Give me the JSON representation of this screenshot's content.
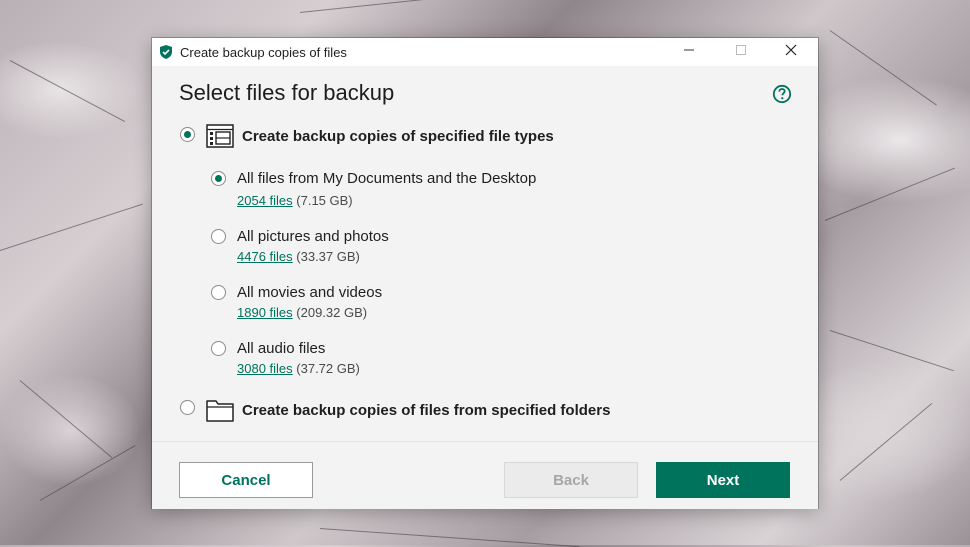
{
  "window": {
    "title": "Create backup copies of files",
    "controls": {
      "minimize": "minimize-icon",
      "maximize": "maximize-icon",
      "close": "close-icon"
    }
  },
  "page": {
    "heading": "Select files for backup",
    "help_icon": "help-icon"
  },
  "options": {
    "file_types": {
      "label": "Create backup copies of specified file types",
      "selected": true
    },
    "folders": {
      "label": "Create backup copies of files from specified folders",
      "selected": false
    }
  },
  "sub_options": [
    {
      "label": "All files from My Documents and the Desktop",
      "files_link": "2054 files",
      "size": "(7.15 GB)",
      "selected": true
    },
    {
      "label": "All pictures and photos",
      "files_link": "4476 files",
      "size": "(33.37 GB)",
      "selected": false
    },
    {
      "label": "All movies and videos",
      "files_link": "1890 files",
      "size": "(209.32 GB)",
      "selected": false
    },
    {
      "label": "All audio files",
      "files_link": "3080 files",
      "size": "(37.72 GB)",
      "selected": false
    }
  ],
  "buttons": {
    "cancel": "Cancel",
    "back": "Back",
    "next": "Next"
  },
  "colors": {
    "accent": "#00735c",
    "window_bg": "#f3f3f3",
    "titlebar_bg": "#ffffff"
  }
}
